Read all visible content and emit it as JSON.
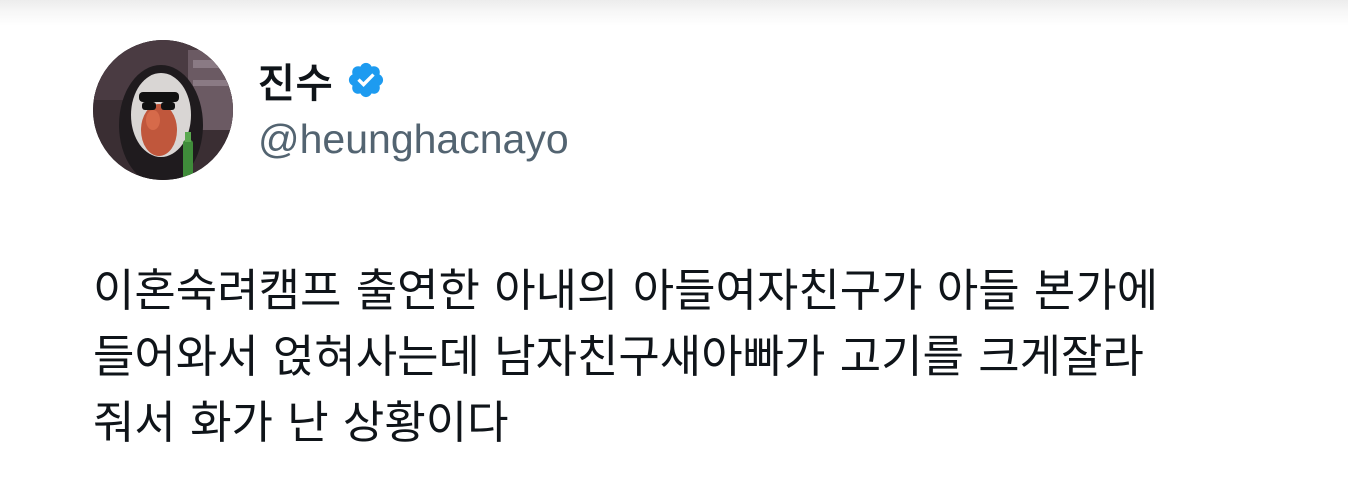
{
  "user": {
    "display_name": "진수",
    "handle": "@heunghacnayo",
    "verified": true,
    "verified_color": "#1d9bf0",
    "avatar_icon": "avatar-hooded-figure"
  },
  "tweet": {
    "lines": [
      "이혼숙려캠프 출연한 아내의 아들여자친구가 아들 본가에",
      "들어와서 얹혀사는데 남자친구새아빠가 고기를 크게잘라",
      "줘서 화가 난 상황이다"
    ]
  },
  "colors": {
    "text_primary": "#0f1419",
    "text_secondary": "#536471",
    "background": "#ffffff"
  }
}
